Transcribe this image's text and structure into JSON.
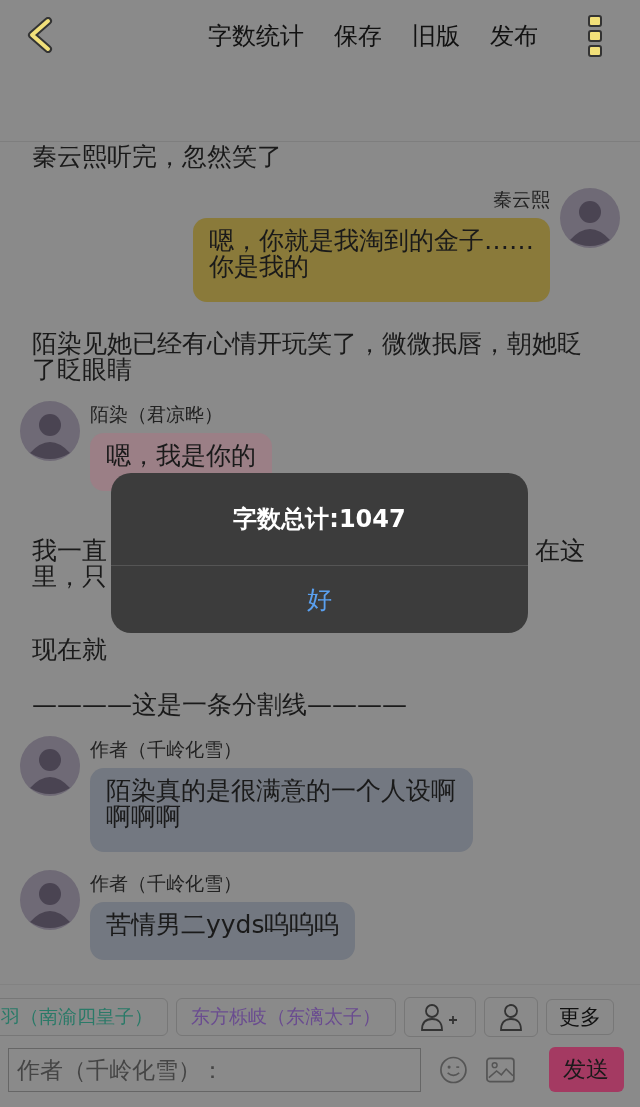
{
  "nav": {
    "actions": [
      "字数统计",
      "保存",
      "旧版",
      "发布"
    ]
  },
  "story": [
    {
      "kind": "narration",
      "text": "秦云熙听完，忽然笑了"
    },
    {
      "kind": "outgoing",
      "name": "秦云熙",
      "text": "嗯，你就是我淘到的金子……\n你是我的",
      "color": "#8a7a3a"
    },
    {
      "kind": "narration",
      "text": "陌染见她已经有心情开玩笑了，微微抿唇，朝她眨了眨眼睛"
    },
    {
      "kind": "incoming",
      "name": "陌染（君凉晔）",
      "text": "嗯，我是你的",
      "color": "#9b7f86"
    },
    {
      "kind": "obscured",
      "lines": [
        {
          "left": "我一直",
          "right": "在这"
        },
        {
          "left": "里，只"
        }
      ]
    },
    {
      "kind": "obscured",
      "lines": [
        {
          "left": "现在就"
        }
      ]
    },
    {
      "kind": "narration",
      "text": "————这是一条分割线————"
    },
    {
      "kind": "incoming",
      "name": "作者（千岭化雪）",
      "text": "陌染真的是很满意的一个人设啊啊啊啊",
      "color": "#737881"
    },
    {
      "kind": "incoming",
      "name": "作者（千岭化雪）",
      "text": "苦情男二yyds呜呜呜",
      "color": "#737881"
    }
  ],
  "roles": [
    {
      "label": "羽（南渝四皇子）",
      "color": "#2a7a68"
    },
    {
      "label": "东方栎岐（东漓太子）",
      "color": "#6a4c90"
    }
  ],
  "toolbar": {
    "more": "更多"
  },
  "composer": {
    "placeholder": "作者（千岭化雪）：",
    "send": "发送"
  },
  "dialog": {
    "title": "字数总计:1047",
    "button": "好"
  }
}
